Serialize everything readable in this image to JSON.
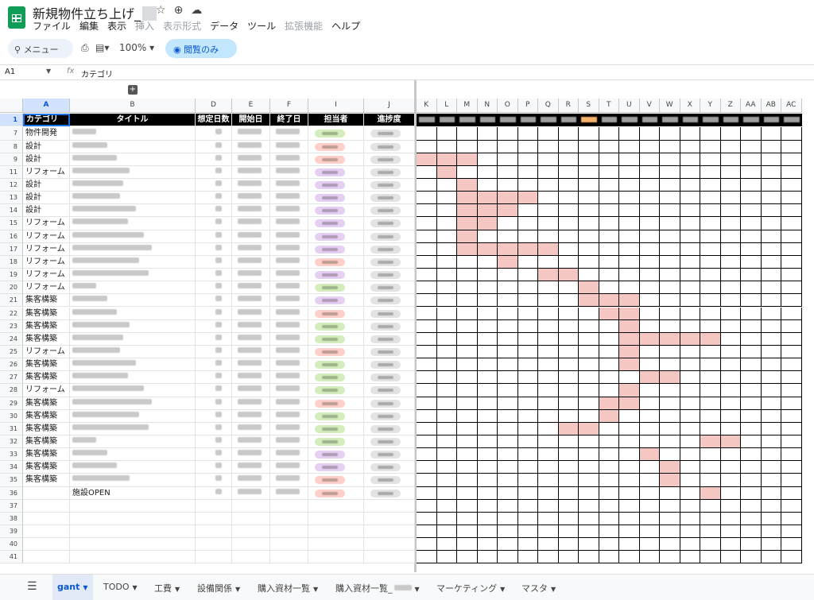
{
  "doc": {
    "title": "新規物件立ち上げ_",
    "title_icons": [
      "star-icon",
      "move-to-drive-icon",
      "cloud-status-icon"
    ]
  },
  "menu": [
    "ファイル",
    "編集",
    "表示",
    "挿入",
    "表示形式",
    "データ",
    "ツール",
    "拡張機能",
    "ヘルプ"
  ],
  "menu_disabled": [
    "挿入",
    "表示形式",
    "拡張機能"
  ],
  "toolbar": {
    "search_label": "メニュー",
    "zoom": "100%",
    "readonly_label": "閲覧のみ"
  },
  "formula_bar": {
    "cell_ref": "A1",
    "fx": "fx",
    "content": "カテゴリ"
  },
  "columns_left": [
    "A",
    "B",
    "D",
    "E",
    "F",
    "I",
    "J"
  ],
  "columns_gantt": [
    "K",
    "L",
    "M",
    "N",
    "O",
    "P",
    "Q",
    "R",
    "S",
    "T",
    "U",
    "V",
    "W",
    "X",
    "Y",
    "Z",
    "AA",
    "AB",
    "AC"
  ],
  "header_row": {
    "row_num": "1",
    "cells": [
      "カテゴリ",
      "タイトル",
      "想定日数",
      "開始日",
      "終了日",
      "担当者",
      "進捗度"
    ]
  },
  "rows": [
    {
      "num": "7",
      "category": "物件開発",
      "chip": "green",
      "gantt": []
    },
    {
      "num": "8",
      "category": "設計",
      "chip": "red",
      "gantt": []
    },
    {
      "num": "9",
      "category": "設計",
      "chip": "red",
      "gantt": [
        0,
        1,
        2
      ]
    },
    {
      "num": "11",
      "category": "リフォーム",
      "chip": "purple",
      "gantt": [
        1
      ]
    },
    {
      "num": "12",
      "category": "設計",
      "chip": "purple",
      "gantt": [
        2
      ]
    },
    {
      "num": "13",
      "category": "設計",
      "chip": "purple",
      "gantt": [
        2,
        3,
        4,
        5
      ]
    },
    {
      "num": "14",
      "category": "設計",
      "chip": "purple",
      "gantt": [
        2,
        3,
        4
      ]
    },
    {
      "num": "15",
      "category": "リフォーム",
      "chip": "purple",
      "gantt": [
        2,
        3
      ]
    },
    {
      "num": "16",
      "category": "リフォーム",
      "chip": "purple",
      "gantt": [
        2
      ]
    },
    {
      "num": "17",
      "category": "リフォーム",
      "chip": "purple",
      "gantt": [
        2,
        3,
        4,
        5,
        6
      ]
    },
    {
      "num": "18",
      "category": "リフォーム",
      "chip": "red",
      "gantt": [
        4
      ]
    },
    {
      "num": "19",
      "category": "リフォーム",
      "chip": "purple",
      "gantt": [
        6,
        7
      ]
    },
    {
      "num": "20",
      "category": "リフォーム",
      "chip": "green",
      "gantt": [
        8
      ]
    },
    {
      "num": "21",
      "category": "集客構築",
      "chip": "purple",
      "gantt": [
        8,
        9,
        10
      ]
    },
    {
      "num": "22",
      "category": "集客構築",
      "chip": "red",
      "gantt": [
        9,
        10
      ]
    },
    {
      "num": "23",
      "category": "集客構築",
      "chip": "green",
      "gantt": [
        10
      ]
    },
    {
      "num": "24",
      "category": "集客構築",
      "chip": "green",
      "gantt": [
        10,
        11,
        12,
        13,
        14
      ]
    },
    {
      "num": "25",
      "category": "リフォーム",
      "chip": "red",
      "gantt": [
        10
      ]
    },
    {
      "num": "26",
      "category": "集客構築",
      "chip": "green",
      "gantt": [
        10
      ]
    },
    {
      "num": "27",
      "category": "集客構築",
      "chip": "green",
      "gantt": [
        11,
        12
      ]
    },
    {
      "num": "28",
      "category": "リフォーム",
      "chip": "green",
      "gantt": [
        10
      ]
    },
    {
      "num": "29",
      "category": "集客構築",
      "chip": "red",
      "gantt": [
        9,
        10
      ]
    },
    {
      "num": "30",
      "category": "集客構築",
      "chip": "green",
      "gantt": [
        9
      ]
    },
    {
      "num": "31",
      "category": "集客構築",
      "chip": "green",
      "gantt": [
        7,
        8
      ]
    },
    {
      "num": "32",
      "category": "集客構築",
      "chip": "green",
      "gantt": [
        14,
        15
      ]
    },
    {
      "num": "33",
      "category": "集客構築",
      "chip": "purple",
      "gantt": [
        11
      ]
    },
    {
      "num": "34",
      "category": "集客構築",
      "chip": "purple",
      "gantt": [
        12
      ]
    },
    {
      "num": "35",
      "category": "集客構築",
      "chip": "red",
      "gantt": [
        12
      ]
    },
    {
      "num": "36",
      "category": "",
      "title": "施設OPEN",
      "chip": "red",
      "gantt": [
        14
      ]
    }
  ],
  "empty_rows": [
    "37",
    "38",
    "39",
    "40",
    "41"
  ],
  "sheet_tabs": [
    {
      "label": "gant",
      "active": true
    },
    {
      "label": "TODO"
    },
    {
      "label": "工費"
    },
    {
      "label": "設備関係"
    },
    {
      "label": "購入資材一覧"
    },
    {
      "label": "購入資材一覧_"
    },
    {
      "label": "マーケティング"
    },
    {
      "label": "マスタ"
    }
  ],
  "colors": {
    "chip_green": "#d4edbc",
    "chip_red": "#ffcfc9",
    "chip_purple": "#e6cff2",
    "gantt_bar": "#f4c7c3",
    "today_marker": "#f6b26b"
  }
}
